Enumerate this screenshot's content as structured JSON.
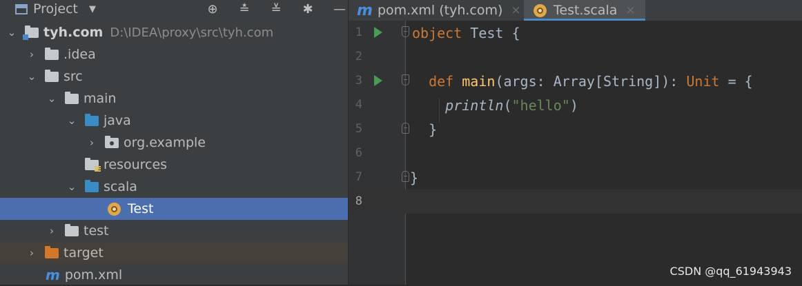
{
  "project_panel": {
    "title": "Project",
    "tree": [
      {
        "label": "tyh.com",
        "path": "D:\\IDEA\\proxy\\src\\tyh.com"
      },
      {
        "label": ".idea"
      },
      {
        "label": "src"
      },
      {
        "label": "main"
      },
      {
        "label": "java"
      },
      {
        "label": "org.example"
      },
      {
        "label": "resources"
      },
      {
        "label": "scala"
      },
      {
        "label": "Test"
      },
      {
        "label": "test"
      },
      {
        "label": "target"
      },
      {
        "label": "pom.xml"
      }
    ]
  },
  "tabs": [
    {
      "label": "pom.xml (tyh.com)",
      "icon": "maven-icon"
    },
    {
      "label": "Test.scala",
      "icon": "scala-object-icon"
    }
  ],
  "editor": {
    "line_numbers": [
      "1",
      "2",
      "3",
      "4",
      "5",
      "6",
      "7",
      "8"
    ],
    "tokens": {
      "l1_kw": "object",
      "l1_rest": " Test {",
      "l3_kw": "def",
      "l3_fn": "main",
      "l3_mid": "(args: Array[String]): ",
      "l3_kw2": "Unit",
      "l3_end": " = {",
      "l4_fn": "println",
      "l4_open": "(",
      "l4_str": "\"hello\"",
      "l4_close": ")",
      "l5": "}",
      "l7": "}"
    }
  },
  "watermark": "CSDN @qq_61943943",
  "colors": {
    "selection": "#4b6eaf",
    "keyword": "#cc7832",
    "function": "#ffc66d",
    "string": "#6a8759",
    "run": "#499c54"
  }
}
